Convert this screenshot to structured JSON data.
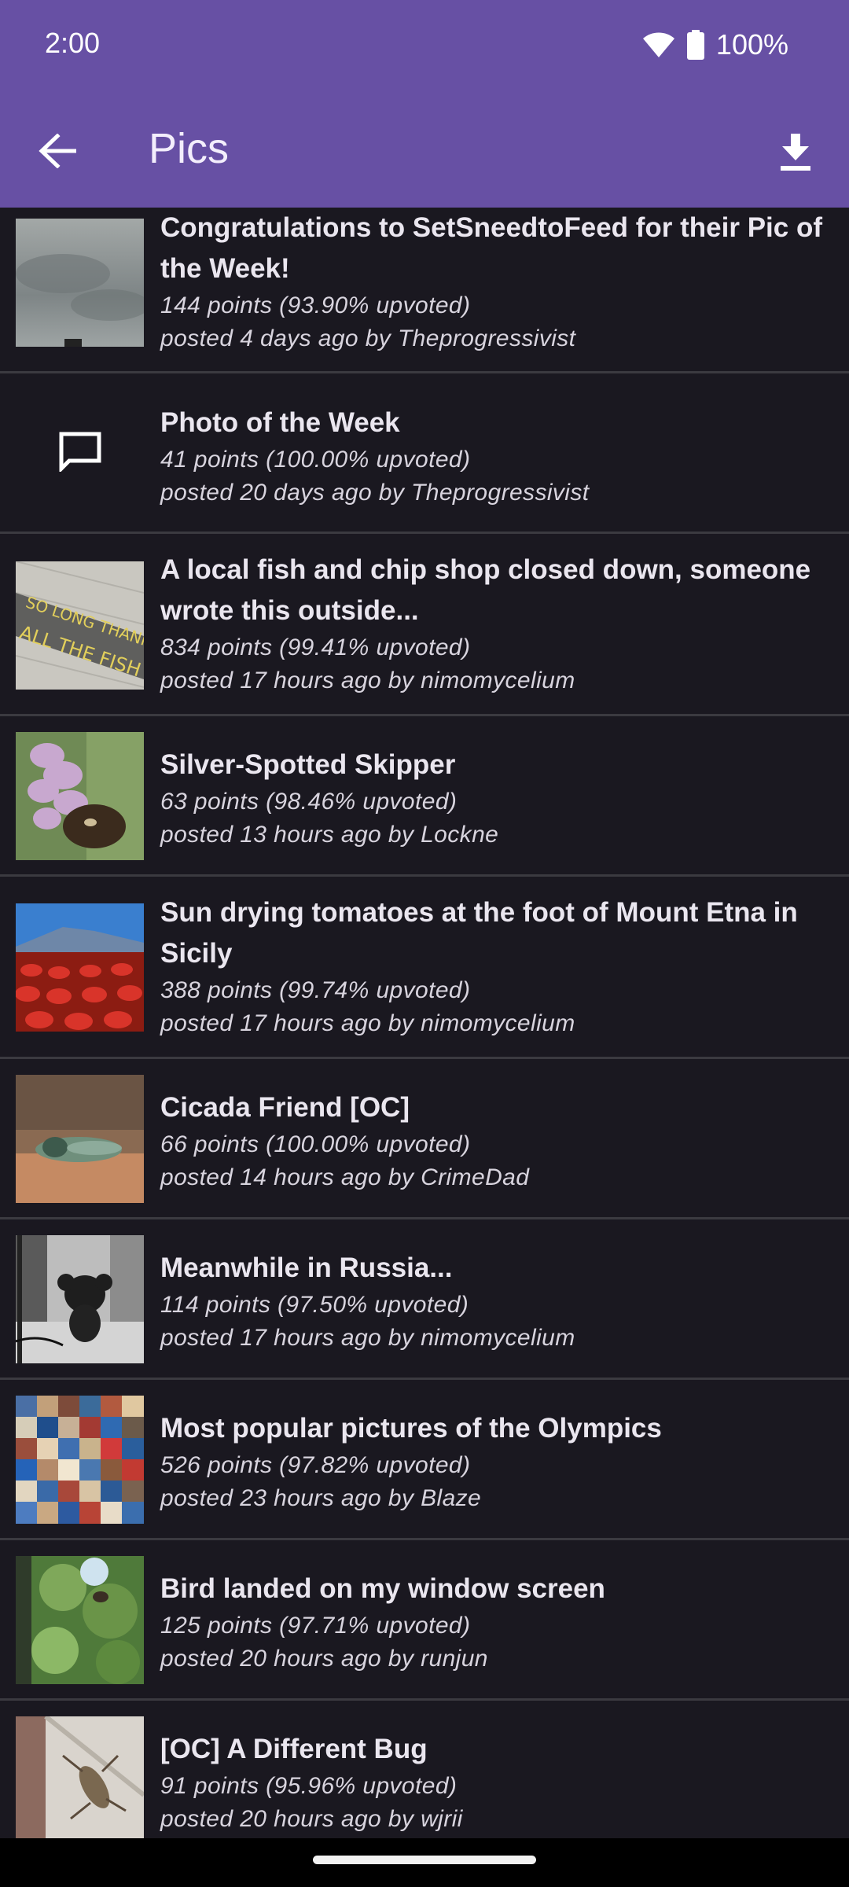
{
  "status_bar": {
    "time": "2:00",
    "battery": "100%",
    "icons": [
      "wifi-icon",
      "battery-icon"
    ]
  },
  "app_bar": {
    "title": "Pics",
    "back_icon": "arrow-left-icon",
    "download_icon": "download-icon"
  },
  "colors": {
    "primary": "#6750a4",
    "background": "#1a1820",
    "divider": "#3b3a40",
    "title_text": "#eae6ef",
    "meta_text": "#d8d4de"
  },
  "posts": [
    {
      "title": "Congratulations to SetSneedtoFeed for their Pic of the Week!",
      "points": "144 points (93.90% upvoted)",
      "posted": "posted 4 days ago by Theprogressivist",
      "thumb": "cloudy-sky-thumbnail"
    },
    {
      "title": "Photo of the Week",
      "points": "41 points (100.00% upvoted)",
      "posted": "posted 20 days ago by Theprogressivist",
      "thumb": "comment-icon"
    },
    {
      "title": "A local fish and chip shop closed down, someone wrote this outside...",
      "points": "834 points (99.41% upvoted)",
      "posted": "posted 17 hours ago by nimomycelium",
      "thumb": "pavement-writing-thumbnail"
    },
    {
      "title": "Silver-Spotted Skipper",
      "points": "63 points (98.46% upvoted)",
      "posted": "posted 13 hours ago by Lockne",
      "thumb": "butterfly-flower-thumbnail"
    },
    {
      "title": "Sun drying tomatoes at the foot of Mount Etna in Sicily",
      "points": "388 points (99.74% upvoted)",
      "posted": "posted 17 hours ago by nimomycelium",
      "thumb": "tomatoes-mountain-thumbnail"
    },
    {
      "title": "Cicada Friend [OC]",
      "points": "66 points (100.00% upvoted)",
      "posted": "posted 14 hours ago by CrimeDad",
      "thumb": "cicada-thumbnail"
    },
    {
      "title": "Meanwhile in Russia...",
      "points": "114 points (97.50% upvoted)",
      "posted": "posted 17 hours ago by nimomycelium",
      "thumb": "street-plush-thumbnail"
    },
    {
      "title": "Most popular pictures of the Olympics",
      "points": "526 points (97.82% upvoted)",
      "posted": "posted 23 hours ago by Blaze",
      "thumb": "olympics-collage-thumbnail"
    },
    {
      "title": "Bird landed on my window screen",
      "points": "125 points (97.71% upvoted)",
      "posted": "posted 20 hours ago by runjun",
      "thumb": "bird-window-thumbnail"
    },
    {
      "title": "[OC] A Different Bug",
      "points": "91 points (95.96% upvoted)",
      "posted": "posted 20 hours ago by wjrii",
      "thumb": "bug-wall-thumbnail"
    }
  ]
}
